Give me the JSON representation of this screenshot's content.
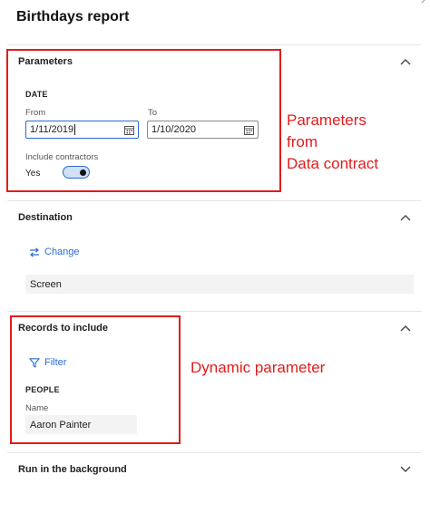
{
  "page": {
    "title": "Birthdays report"
  },
  "parameters": {
    "title": "Parameters",
    "group_label": "DATE",
    "from_label": "From",
    "from_value": "1/11/2019",
    "to_label": "To",
    "to_value": "1/10/2020",
    "contractors_label": "Include contractors",
    "contractors_value": "Yes"
  },
  "destination": {
    "title": "Destination",
    "change_label": "Change",
    "value": "Screen"
  },
  "records": {
    "title": "Records to include",
    "filter_label": "Filter",
    "group_label": "PEOPLE",
    "name_label": "Name",
    "name_value": "Aaron Painter"
  },
  "background": {
    "title": "Run in the background"
  },
  "annotations": {
    "contract_line1": "Parameters",
    "contract_line2": "from",
    "contract_line3": "Data contract",
    "dynamic": "Dynamic parameter"
  },
  "colors": {
    "accent": "#2b6bd6",
    "annotation_red": "#e21b1b"
  }
}
